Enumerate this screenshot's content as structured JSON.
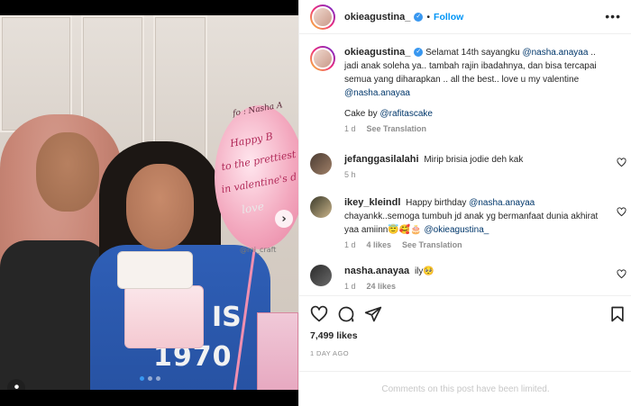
{
  "post": {
    "author": {
      "username": "okieagustina_",
      "verified": true,
      "follow_label": "Follow",
      "separator": "•"
    },
    "photo": {
      "carousel_dots": 3,
      "active_dot": 0,
      "shirt_text_line1": "1970",
      "shirt_text_line2": "IS",
      "balloon_line1": "Happy B",
      "balloon_line2": "to the prettiest",
      "balloon_line3": "in valentine's d",
      "balloon_line4": "love",
      "balloon_top": "fo : Nasha A",
      "watermark": "@mi_craft"
    },
    "caption": {
      "username": "okieagustina_",
      "text_1": "Selamat 14th sayangku ",
      "mention_1": "@nasha.anayaa",
      "text_2": " .. jadi anak soleha ya.. tambah rajin ibadahnya, dan bisa tercapai semua yang diharapkan .. all the best.. love u my valentine ",
      "mention_2": "@nasha.anayaa",
      "cake_text": "Cake by ",
      "cake_mention": "@rafitascake",
      "time": "1 d",
      "see_translation": "See Translation"
    },
    "comments": [
      {
        "username": "jefanggasilalahi",
        "text": "Mirip brisia jodie deh kak",
        "time": "5 h"
      },
      {
        "username": "ikey_kleindl",
        "text_1": "Happy birthday ",
        "mention_1": "@nasha.anayaa",
        "text_2": " chayankk..semoga tumbuh jd anak yg bermanfaat dunia akhirat yaa amiinn😇🥰🎂 ",
        "mention_2": "@okieagustina_",
        "time": "1 d",
        "likes": "4 likes",
        "see_translation": "See Translation"
      },
      {
        "username": "nasha.anayaa",
        "text": "ily🥺",
        "time": "1 d",
        "likes": "24 likes"
      }
    ],
    "likes_count": "7,499 likes",
    "posted_ago": "1 DAY AGO",
    "comments_limited": "Comments on this post have been limited."
  }
}
